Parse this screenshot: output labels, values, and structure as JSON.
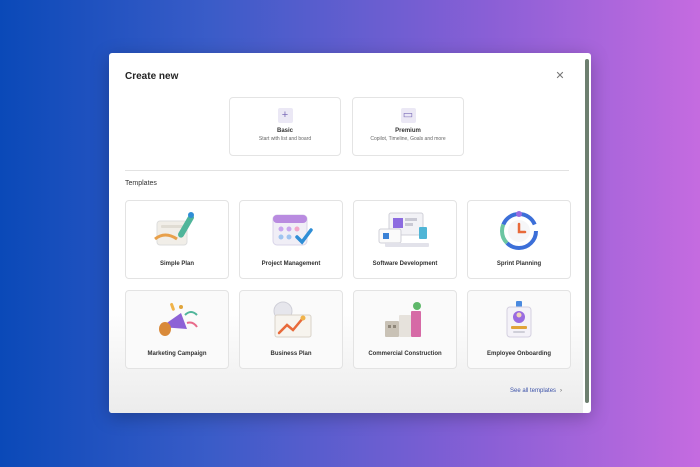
{
  "dialog": {
    "title": "Create new",
    "close_glyph": "✕"
  },
  "start_options": [
    {
      "title": "Basic",
      "subtitle": "Start with list and board",
      "icon": "plus-icon",
      "glyph": "+"
    },
    {
      "title": "Premium",
      "subtitle": "Copilot, Timeline, Goals and more",
      "icon": "premium-plan-icon",
      "glyph": "▭"
    }
  ],
  "templates": {
    "heading": "Templates",
    "items": [
      {
        "label": "Simple Plan",
        "icon": "paint-brush-icon"
      },
      {
        "label": "Project Management",
        "icon": "calendar-check-icon"
      },
      {
        "label": "Software Development",
        "icon": "laptop-icon"
      },
      {
        "label": "Sprint Planning",
        "icon": "clock-ring-icon"
      },
      {
        "label": "Marketing Campaign",
        "icon": "megaphone-icon"
      },
      {
        "label": "Business Plan",
        "icon": "chart-board-icon"
      },
      {
        "label": "Commercial Construction",
        "icon": "buildings-icon"
      },
      {
        "label": "Employee Onboarding",
        "icon": "badge-icon"
      }
    ]
  },
  "footer": {
    "see_all": "See all templates",
    "chevron": "›"
  },
  "colors": {
    "accent": "#3c52a8",
    "background_left": "#0a49b8",
    "background_right": "#c56be0"
  }
}
